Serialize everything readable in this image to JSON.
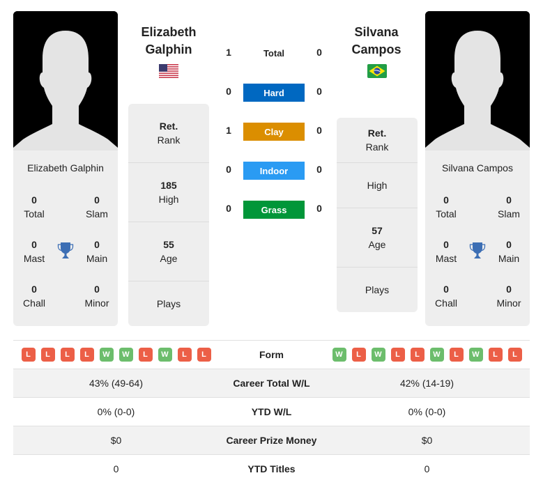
{
  "player1": {
    "name_line1": "Elizabeth",
    "name_line2": "Galphin",
    "full_name": "Elizabeth Galphin",
    "flag": "us-flag-icon",
    "titles": {
      "total": "0",
      "slam": "0",
      "mast": "0",
      "main": "0",
      "chall": "0",
      "minor": "0"
    },
    "rank_value": "Ret.",
    "high_value": "185",
    "age_value": "55",
    "plays_value": "",
    "form": [
      "L",
      "L",
      "L",
      "L",
      "W",
      "W",
      "L",
      "W",
      "L",
      "L"
    ],
    "career_total_wl": "43% (49-64)",
    "ytd_wl": "0% (0-0)",
    "career_prize": "$0",
    "ytd_titles": "0"
  },
  "player2": {
    "name_line1": "Silvana",
    "name_line2": "Campos",
    "full_name": "Silvana Campos",
    "flag": "brazil-flag-icon",
    "titles": {
      "total": "0",
      "slam": "0",
      "mast": "0",
      "main": "0",
      "chall": "0",
      "minor": "0"
    },
    "rank_value": "Ret.",
    "high_value": "",
    "age_value": "57",
    "plays_value": "",
    "form": [
      "W",
      "L",
      "W",
      "L",
      "L",
      "W",
      "L",
      "W",
      "L",
      "L"
    ],
    "career_total_wl": "42% (14-19)",
    "ytd_wl": "0% (0-0)",
    "career_prize": "$0",
    "ytd_titles": "0"
  },
  "labels": {
    "total": "Total",
    "slam": "Slam",
    "mast": "Mast",
    "main": "Main",
    "chall": "Chall",
    "minor": "Minor",
    "rank": "Rank",
    "high": "High",
    "age": "Age",
    "plays": "Plays",
    "form": "Form",
    "career_total_wl": "Career Total W/L",
    "ytd_wl": "YTD W/L",
    "career_prize": "Career Prize Money",
    "ytd_titles": "YTD Titles"
  },
  "h2h": {
    "total": {
      "label": "Total",
      "p1": "1",
      "p2": "0"
    },
    "surfaces": [
      {
        "label": "Hard",
        "p1": "0",
        "p2": "0",
        "color": "#0068c1"
      },
      {
        "label": "Clay",
        "p1": "1",
        "p2": "0",
        "color": "#db8e00"
      },
      {
        "label": "Indoor",
        "p1": "0",
        "p2": "0",
        "color": "#2a9bf3"
      },
      {
        "label": "Grass",
        "p1": "0",
        "p2": "0",
        "color": "#019639"
      }
    ]
  },
  "colors": {
    "loss": "#ec5f47",
    "win": "#6cbd6c",
    "trophy": "#3c6eb4",
    "card_bg": "#eeeeee"
  }
}
